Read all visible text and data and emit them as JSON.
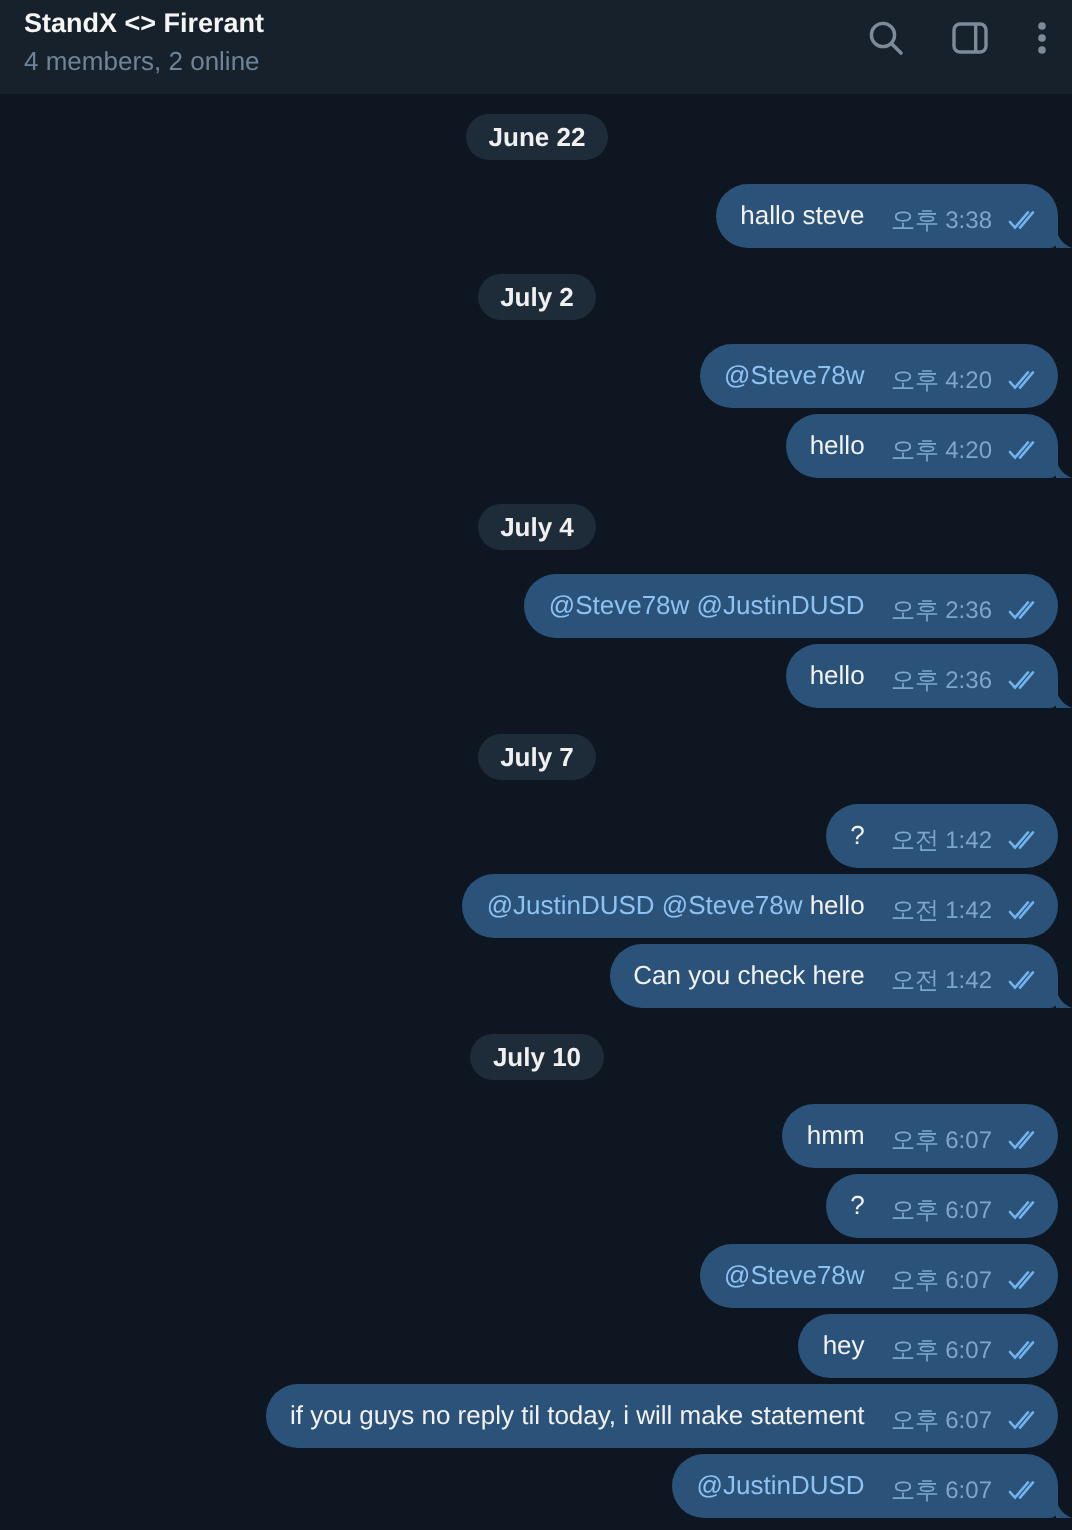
{
  "header": {
    "title": "StandX <> Firerant",
    "subtitle": "4 members, 2 online"
  },
  "groups": [
    {
      "date": "June 22",
      "messages": [
        {
          "parts": [
            {
              "kind": "plain",
              "text": "hallo steve"
            }
          ],
          "time": "오후 3:38",
          "read": true
        }
      ]
    },
    {
      "date": "July 2",
      "messages": [
        {
          "parts": [
            {
              "kind": "mention",
              "text": "@Steve78w"
            }
          ],
          "time": "오후 4:20",
          "read": true
        },
        {
          "parts": [
            {
              "kind": "plain",
              "text": "hello"
            }
          ],
          "time": "오후 4:20",
          "read": true
        }
      ]
    },
    {
      "date": "July 4",
      "messages": [
        {
          "parts": [
            {
              "kind": "mention",
              "text": "@Steve78w @JustinDUSD"
            }
          ],
          "time": "오후 2:36",
          "read": true
        },
        {
          "parts": [
            {
              "kind": "plain",
              "text": "hello"
            }
          ],
          "time": "오후 2:36",
          "read": true
        }
      ]
    },
    {
      "date": "July 7",
      "messages": [
        {
          "parts": [
            {
              "kind": "plain",
              "text": "?"
            }
          ],
          "time": "오전 1:42",
          "read": true
        },
        {
          "parts": [
            {
              "kind": "mention",
              "text": "@JustinDUSD @Steve78w"
            },
            {
              "kind": "plain",
              "text": " hello"
            }
          ],
          "time": "오전 1:42",
          "read": true
        },
        {
          "parts": [
            {
              "kind": "plain",
              "text": "Can you check here"
            }
          ],
          "time": "오전 1:42",
          "read": true
        }
      ]
    },
    {
      "date": "July 10",
      "messages": [
        {
          "parts": [
            {
              "kind": "plain",
              "text": "hmm"
            }
          ],
          "time": "오후 6:07",
          "read": true
        },
        {
          "parts": [
            {
              "kind": "plain",
              "text": "?"
            }
          ],
          "time": "오후 6:07",
          "read": true
        },
        {
          "parts": [
            {
              "kind": "mention",
              "text": "@Steve78w"
            }
          ],
          "time": "오후 6:07",
          "read": true
        },
        {
          "parts": [
            {
              "kind": "plain",
              "text": "hey"
            }
          ],
          "time": "오후 6:07",
          "read": true
        },
        {
          "parts": [
            {
              "kind": "plain",
              "text": "if you guys no reply til today, i will make statement"
            }
          ],
          "time": "오후 6:07",
          "read": true
        },
        {
          "parts": [
            {
              "kind": "mention",
              "text": "@JustinDUSD"
            }
          ],
          "time": "오후 6:07",
          "read": true
        }
      ]
    }
  ]
}
